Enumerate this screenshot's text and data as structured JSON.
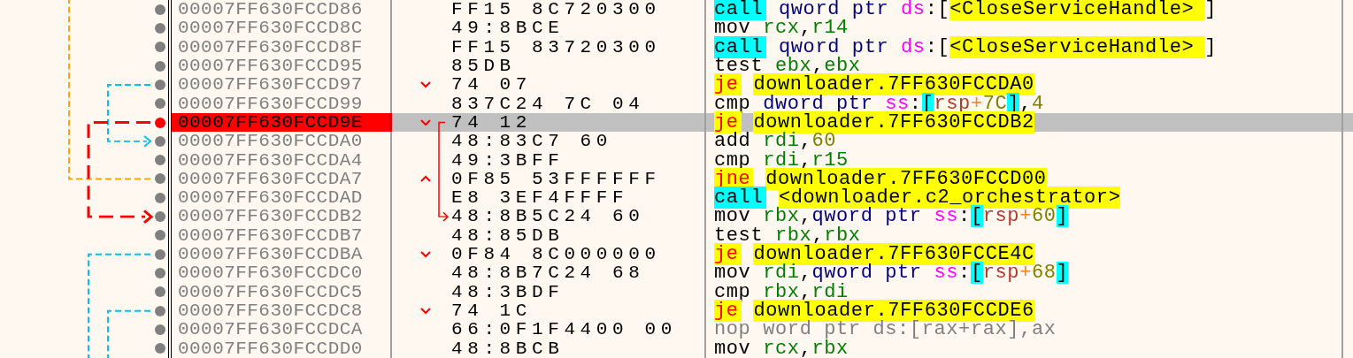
{
  "rows": [
    {
      "address": "00007FF630FCCD86",
      "breakpoint": false,
      "selected": false,
      "branch_marker": false,
      "bytes": "FF15 8C720300",
      "instruction": [
        {
          "text": "call",
          "kind": "call"
        },
        {
          "text": "qword ptr",
          "kind": "keyword"
        },
        {
          "text": "ds",
          "kind": "segment"
        },
        {
          "text": ":",
          "kind": "punct",
          "tight": true
        },
        {
          "text": "[",
          "kind": "punct",
          "tight": true
        },
        {
          "text": "<CloseServiceHandle>",
          "kind": "label",
          "tight": true
        },
        {
          "text": "]",
          "kind": "punct",
          "tight": true
        }
      ]
    },
    {
      "address": "00007FF630FCCD8C",
      "breakpoint": false,
      "selected": false,
      "branch_marker": false,
      "bytes": "49:8BCE",
      "instruction": [
        {
          "text": "mov",
          "kind": "mnemonic"
        },
        {
          "text": "rcx",
          "kind": "register"
        },
        {
          "text": ",",
          "kind": "punct",
          "tight": true
        },
        {
          "text": "r14",
          "kind": "register",
          "tight": true
        }
      ]
    },
    {
      "address": "00007FF630FCCD8F",
      "breakpoint": false,
      "selected": false,
      "branch_marker": false,
      "bytes": "FF15 83720300",
      "instruction": [
        {
          "text": "call",
          "kind": "call"
        },
        {
          "text": "qword ptr",
          "kind": "keyword"
        },
        {
          "text": "ds",
          "kind": "segment"
        },
        {
          "text": ":",
          "kind": "punct",
          "tight": true
        },
        {
          "text": "[",
          "kind": "punct",
          "tight": true
        },
        {
          "text": "<CloseServiceHandle>",
          "kind": "label",
          "tight": true
        },
        {
          "text": "]",
          "kind": "punct",
          "tight": true
        }
      ]
    },
    {
      "address": "00007FF630FCCD95",
      "breakpoint": false,
      "selected": false,
      "branch_marker": false,
      "bytes": "85DB",
      "instruction": [
        {
          "text": "test",
          "kind": "mnemonic"
        },
        {
          "text": "ebx",
          "kind": "register"
        },
        {
          "text": ",",
          "kind": "punct",
          "tight": true
        },
        {
          "text": "ebx",
          "kind": "register",
          "tight": true
        }
      ]
    },
    {
      "address": "00007FF630FCCD97",
      "breakpoint": false,
      "selected": false,
      "branch_marker": true,
      "branch_up": false,
      "bytes": "74 07",
      "instruction": [
        {
          "text": "je",
          "kind": "jump"
        },
        {
          "text": "downloader.7FF630FCCDA0",
          "kind": "label"
        }
      ]
    },
    {
      "address": "00007FF630FCCD99",
      "breakpoint": false,
      "selected": false,
      "branch_marker": false,
      "bytes": "837C24 7C 04",
      "instruction": [
        {
          "text": "cmp",
          "kind": "mnemonic"
        },
        {
          "text": "dword ptr",
          "kind": "keyword"
        },
        {
          "text": "ss",
          "kind": "segment"
        },
        {
          "text": ":",
          "kind": "punct",
          "tight": true
        },
        {
          "text": "[",
          "kind": "bracket",
          "tight": true
        },
        {
          "text": "rsp",
          "kind": "memreg",
          "tight": true
        },
        {
          "text": "+",
          "kind": "plus",
          "tight": true
        },
        {
          "text": "7C",
          "kind": "number",
          "tight": true
        },
        {
          "text": "]",
          "kind": "bracket",
          "tight": true
        },
        {
          "text": ",",
          "kind": "punct",
          "tight": true
        },
        {
          "text": "4",
          "kind": "number",
          "tight": true
        }
      ]
    },
    {
      "address": "00007FF630FCCD9E",
      "breakpoint": true,
      "selected": true,
      "branch_marker": true,
      "branch_up": false,
      "bytes": "74 12",
      "instruction": [
        {
          "text": "je",
          "kind": "jump"
        },
        {
          "text": "downloader.7FF630FCCDB2",
          "kind": "label"
        }
      ]
    },
    {
      "address": "00007FF630FCCDA0",
      "breakpoint": false,
      "selected": false,
      "branch_marker": false,
      "bytes": "48:83C7 60",
      "instruction": [
        {
          "text": "add",
          "kind": "mnemonic"
        },
        {
          "text": "rdi",
          "kind": "register"
        },
        {
          "text": ",",
          "kind": "punct",
          "tight": true
        },
        {
          "text": "60",
          "kind": "number",
          "tight": true
        }
      ]
    },
    {
      "address": "00007FF630FCCDA4",
      "breakpoint": false,
      "selected": false,
      "branch_marker": false,
      "bytes": "49:3BFF",
      "instruction": [
        {
          "text": "cmp",
          "kind": "mnemonic"
        },
        {
          "text": "rdi",
          "kind": "register"
        },
        {
          "text": ",",
          "kind": "punct",
          "tight": true
        },
        {
          "text": "r15",
          "kind": "register",
          "tight": true
        }
      ]
    },
    {
      "address": "00007FF630FCCDA7",
      "breakpoint": false,
      "selected": false,
      "branch_marker": true,
      "branch_up": true,
      "bytes": "0F85 53FFFFFF",
      "instruction": [
        {
          "text": "jne",
          "kind": "jump"
        },
        {
          "text": "downloader.7FF630FCCD00",
          "kind": "label"
        }
      ]
    },
    {
      "address": "00007FF630FCCDAD",
      "breakpoint": false,
      "selected": false,
      "branch_marker": false,
      "bytes": "E8 3EF4FFFF",
      "instruction": [
        {
          "text": "call",
          "kind": "call"
        },
        {
          "text": "<downloader.c2_orchestrator>",
          "kind": "label"
        }
      ]
    },
    {
      "address": "00007FF630FCCDB2",
      "breakpoint": false,
      "selected": false,
      "branch_marker": false,
      "bytes": "48:8B5C24 60",
      "instruction": [
        {
          "text": "mov",
          "kind": "mnemonic"
        },
        {
          "text": "rbx",
          "kind": "register"
        },
        {
          "text": ",",
          "kind": "punct",
          "tight": true
        },
        {
          "text": "qword ptr",
          "kind": "keyword",
          "tight": true
        },
        {
          "text": "ss",
          "kind": "segment"
        },
        {
          "text": ":",
          "kind": "punct",
          "tight": true
        },
        {
          "text": "[",
          "kind": "bracket",
          "tight": true
        },
        {
          "text": "rsp",
          "kind": "memreg",
          "tight": true
        },
        {
          "text": "+",
          "kind": "plus",
          "tight": true
        },
        {
          "text": "60",
          "kind": "number",
          "tight": true
        },
        {
          "text": "]",
          "kind": "bracket",
          "tight": true
        }
      ]
    },
    {
      "address": "00007FF630FCCDB7",
      "breakpoint": false,
      "selected": false,
      "branch_marker": false,
      "bytes": "48:85DB",
      "instruction": [
        {
          "text": "test",
          "kind": "mnemonic"
        },
        {
          "text": "rbx",
          "kind": "register"
        },
        {
          "text": ",",
          "kind": "punct",
          "tight": true
        },
        {
          "text": "rbx",
          "kind": "register",
          "tight": true
        }
      ]
    },
    {
      "address": "00007FF630FCCDBA",
      "breakpoint": false,
      "selected": false,
      "branch_marker": true,
      "branch_up": false,
      "bytes": "0F84 8C000000",
      "instruction": [
        {
          "text": "je",
          "kind": "jump"
        },
        {
          "text": "downloader.7FF630FCCE4C",
          "kind": "label"
        }
      ]
    },
    {
      "address": "00007FF630FCCDC0",
      "breakpoint": false,
      "selected": false,
      "branch_marker": false,
      "bytes": "48:8B7C24 68",
      "instruction": [
        {
          "text": "mov",
          "kind": "mnemonic"
        },
        {
          "text": "rdi",
          "kind": "register"
        },
        {
          "text": ",",
          "kind": "punct",
          "tight": true
        },
        {
          "text": "qword ptr",
          "kind": "keyword",
          "tight": true
        },
        {
          "text": "ss",
          "kind": "segment"
        },
        {
          "text": ":",
          "kind": "punct",
          "tight": true
        },
        {
          "text": "[",
          "kind": "bracket",
          "tight": true
        },
        {
          "text": "rsp",
          "kind": "memreg",
          "tight": true
        },
        {
          "text": "+",
          "kind": "plus",
          "tight": true
        },
        {
          "text": "68",
          "kind": "number",
          "tight": true
        },
        {
          "text": "]",
          "kind": "bracket",
          "tight": true
        }
      ]
    },
    {
      "address": "00007FF630FCCDC5",
      "breakpoint": false,
      "selected": false,
      "branch_marker": false,
      "bytes": "48:3BDF",
      "instruction": [
        {
          "text": "cmp",
          "kind": "mnemonic"
        },
        {
          "text": "rbx",
          "kind": "register"
        },
        {
          "text": ",",
          "kind": "punct",
          "tight": true
        },
        {
          "text": "rdi",
          "kind": "register",
          "tight": true
        }
      ]
    },
    {
      "address": "00007FF630FCCDC8",
      "breakpoint": false,
      "selected": false,
      "branch_marker": true,
      "branch_up": false,
      "bytes": "74 1C",
      "instruction": [
        {
          "text": "je",
          "kind": "jump"
        },
        {
          "text": "downloader.7FF630FCCDE6",
          "kind": "label"
        }
      ]
    },
    {
      "address": "00007FF630FCCDCA",
      "breakpoint": false,
      "selected": false,
      "branch_marker": false,
      "bytes": "66:0F1F4400 00",
      "instruction": [
        {
          "text": "nop",
          "kind": "muted"
        },
        {
          "text": "word ptr",
          "kind": "muted"
        },
        {
          "text": "ds",
          "kind": "muted"
        },
        {
          "text": ":",
          "kind": "muted",
          "tight": true
        },
        {
          "text": "[",
          "kind": "muted",
          "tight": true
        },
        {
          "text": "rax",
          "kind": "muted",
          "tight": true
        },
        {
          "text": "+",
          "kind": "muted",
          "tight": true
        },
        {
          "text": "rax",
          "kind": "muted",
          "tight": true
        },
        {
          "text": "]",
          "kind": "muted",
          "tight": true
        },
        {
          "text": ",",
          "kind": "muted",
          "tight": true
        },
        {
          "text": "ax",
          "kind": "muted",
          "tight": true
        }
      ]
    },
    {
      "address": "00007FF630FCCDD0",
      "breakpoint": false,
      "selected": false,
      "branch_marker": false,
      "bytes": "48:8BCB",
      "instruction": [
        {
          "text": "mov",
          "kind": "mnemonic"
        },
        {
          "text": "rcx",
          "kind": "register"
        },
        {
          "text": ",",
          "kind": "punct",
          "tight": true
        },
        {
          "text": "rbx",
          "kind": "register",
          "tight": true
        }
      ]
    }
  ]
}
